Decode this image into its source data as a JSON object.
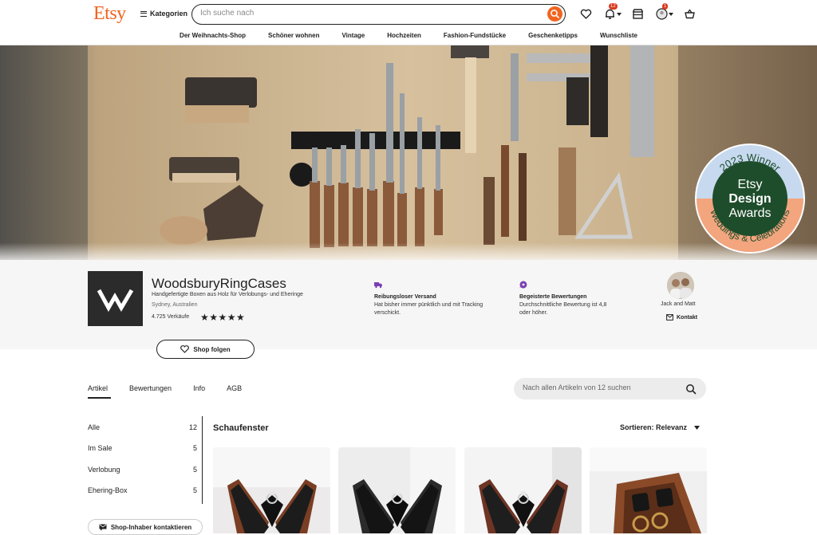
{
  "header": {
    "logo": "Etsy",
    "categories_label": "Kategorien",
    "search_placeholder": "Ich suche nach",
    "notifications_count": "12",
    "account_badge": "1"
  },
  "nav": [
    "Der Weihnachts-Shop",
    "Schöner wohnen",
    "Vintage",
    "Hochzeiten",
    "Fashion-Fundstücke",
    "Geschenketipps",
    "Wunschliste"
  ],
  "award": {
    "year": "2023 Winner",
    "line1": "Etsy",
    "line2": "Design",
    "line3": "Awards",
    "category": "Weddings & Celebrations"
  },
  "shop": {
    "name": "WoodsburyRingCases",
    "tagline": "Handgefertigte Boxen aus Holz für Verlobungs- und Eheringe",
    "location": "Sydney, Australien",
    "sales": "4.725 Verkäufe",
    "stars": "★★★★★",
    "follow_label": "Shop folgen"
  },
  "features": [
    {
      "title": "Reibungsloser Versand",
      "line1": "Hat bisher immer pünktlich und mit Tracking",
      "line2": "verschickt."
    },
    {
      "title": "Begeisterte Bewertungen",
      "line1": "Durchschnittliche Bewertung ist 4,8",
      "line2": "oder höher."
    }
  ],
  "owner": {
    "name": "Jack and Matt",
    "contact_label": "Kontakt"
  },
  "tabs": [
    "Artikel",
    "Bewertungen",
    "Info",
    "AGB"
  ],
  "shop_search_placeholder": "Nach allen Artikeln von 12 suchen",
  "categories": [
    {
      "label": "Alle",
      "count": "12"
    },
    {
      "label": "Im Sale",
      "count": "5"
    },
    {
      "label": "Verlobung",
      "count": "5"
    },
    {
      "label": "Ehering-Box",
      "count": "5"
    }
  ],
  "section_title": "Schaufenster",
  "sort_label": "Sortieren: Relevanz",
  "contact_owner_label": "Shop-Inhaber kontaktieren",
  "colors": {
    "accent": "#f1641e",
    "award_green": "#1e4d2b",
    "award_blue": "#c7d9ef",
    "award_peach": "#f3a57e"
  }
}
